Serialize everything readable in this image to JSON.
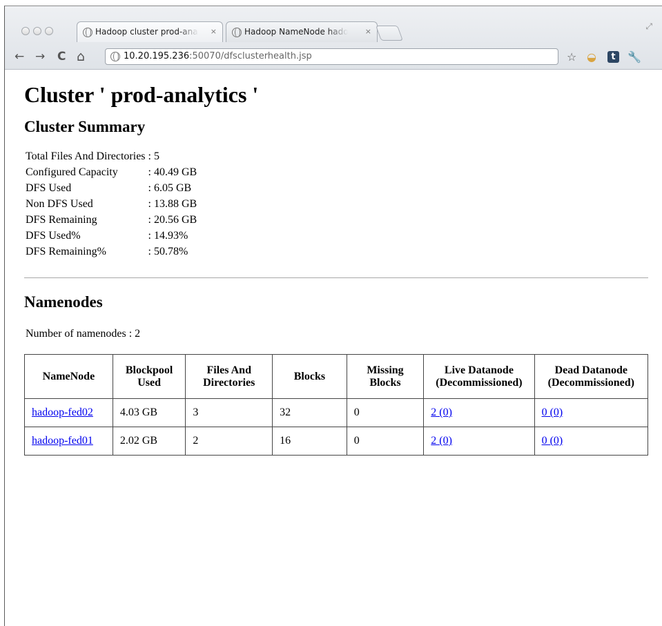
{
  "browser": {
    "tabs": [
      {
        "title": "Hadoop cluster prod-analytic",
        "close": "×",
        "active": true
      },
      {
        "title": "Hadoop NameNode hadoop-",
        "close": "×",
        "active": false
      }
    ],
    "nav": {
      "back": "←",
      "forward": "→",
      "reload": "C",
      "home": "⌂"
    },
    "url": {
      "host": "10.20.195.236",
      "rest": ":50070/dfsclusterhealth.jsp"
    },
    "toolbar_icons": [
      "star-icon",
      "extension-icon",
      "tumblr-icon",
      "wrench-icon"
    ],
    "tumblr_letter": "t"
  },
  "page": {
    "title": "Cluster ' prod-analytics '",
    "summary_heading": "Cluster Summary",
    "summary": [
      {
        "label": "Total Files And Directories",
        "value": ": 5"
      },
      {
        "label": "Configured Capacity",
        "value": ": 40.49 GB"
      },
      {
        "label": "DFS Used",
        "value": ": 6.05 GB"
      },
      {
        "label": "Non DFS Used",
        "value": ": 13.88 GB"
      },
      {
        "label": "DFS Remaining",
        "value": ": 20.56 GB"
      },
      {
        "label": "DFS Used%",
        "value": ": 14.93%"
      },
      {
        "label": "DFS Remaining%",
        "value": ": 50.78%"
      }
    ],
    "namenodes_heading": "Namenodes",
    "namenode_count": "Number of namenodes : 2",
    "table": {
      "headers": [
        {
          "l1": "NameNode",
          "l2": ""
        },
        {
          "l1": "Blockpool",
          "l2": "Used"
        },
        {
          "l1": "Files And",
          "l2": "Directories"
        },
        {
          "l1": "Blocks",
          "l2": ""
        },
        {
          "l1": "Missing",
          "l2": "Blocks"
        },
        {
          "l1": "Live Datanode",
          "l2": "(Decommissioned)"
        },
        {
          "l1": "Dead Datanode",
          "l2": "(Decommissioned)"
        }
      ],
      "rows": [
        {
          "namenode": "hadoop-fed02",
          "blockpool_used": "4.03 GB",
          "files": "3",
          "blocks": "32",
          "missing": "0",
          "live": "2 (0)",
          "dead": "0 (0)"
        },
        {
          "namenode": "hadoop-fed01",
          "blockpool_used": "2.02 GB",
          "files": "2",
          "blocks": "16",
          "missing": "0",
          "live": "2 (0)",
          "dead": "0 (0)"
        }
      ]
    }
  }
}
